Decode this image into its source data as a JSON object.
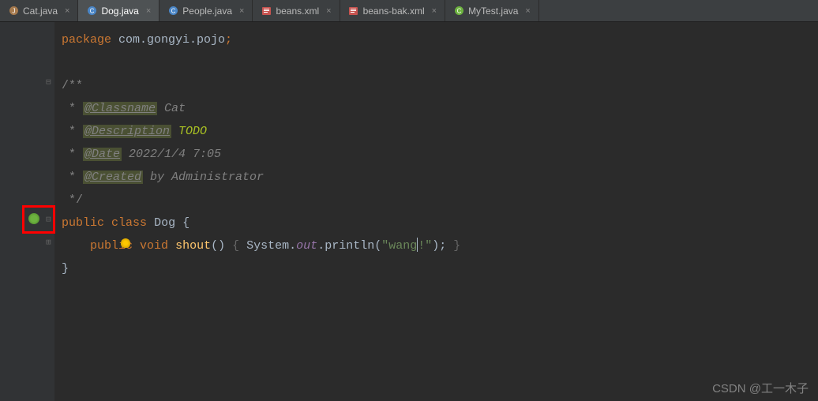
{
  "tabs": [
    {
      "label": "Cat.java",
      "icon": "java",
      "active": false
    },
    {
      "label": "Dog.java",
      "icon": "class",
      "active": true
    },
    {
      "label": "People.java",
      "icon": "class",
      "active": false
    },
    {
      "label": "beans.xml",
      "icon": "xml",
      "active": false
    },
    {
      "label": "beans-bak.xml",
      "icon": "xml",
      "active": false
    },
    {
      "label": "MyTest.java",
      "icon": "class",
      "active": false
    }
  ],
  "code": {
    "package_kw": "package",
    "package_name": " com.gongyi.pojo",
    "doc_open": "/**",
    "tag_classname": "@Classname",
    "val_classname": " Cat",
    "tag_description": "@Description",
    "val_description": " TODO",
    "tag_date": "@Date",
    "val_date": " 2022/1/4 7:05",
    "tag_created": "@Created",
    "val_created": " by Administrator",
    "doc_close": " */",
    "public": "public",
    "class": "class",
    "classname": "Dog",
    "void": "void",
    "method": "shout",
    "system": "System",
    "out": "out",
    "println": "println",
    "string1": "\"wang",
    "string2": "!\""
  },
  "watermark": "CSDN @工一木子"
}
